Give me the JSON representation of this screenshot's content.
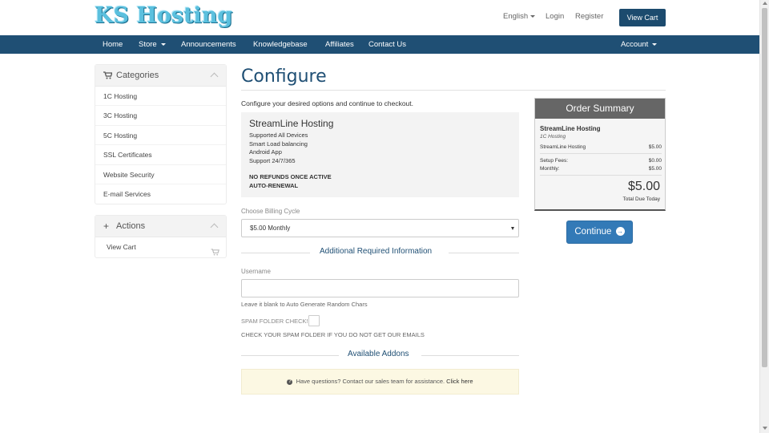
{
  "header": {
    "logo": "KS Hosting",
    "language": "English",
    "login": "Login",
    "register": "Register",
    "view_cart": "View Cart"
  },
  "nav": {
    "home": "Home",
    "store": "Store",
    "announcements": "Announcements",
    "knowledgebase": "Knowledgebase",
    "affiliates": "Affiliates",
    "contact": "Contact Us",
    "account": "Account"
  },
  "sidebar": {
    "categories_title": "Categories",
    "categories": [
      "1C Hosting",
      "3C Hosting",
      "5C Hosting",
      "SSL Certificates",
      "Website Security",
      "E-mail Services"
    ],
    "actions_title": "Actions",
    "actions": [
      "View Cart"
    ]
  },
  "main": {
    "title": "Configure",
    "intro": "Configure your desired options and continue to checkout.",
    "product": {
      "name": "StreamLine Hosting",
      "features": [
        "Supported All Devices",
        "Smart Load balancing",
        "Android App",
        "Support 24/7/365"
      ],
      "notes": [
        "NO REFUNDS ONCE ACTIVE",
        "AUTO-RENEWAL"
      ]
    },
    "billing_label": "Choose Billing Cycle",
    "billing_value": "$5.00 Monthly",
    "additional_info": "Additional Required Information",
    "username_label": "Username",
    "username_value": "",
    "username_help": "Leave it blank to Auto Generate Random Chars",
    "spam_label": "SPAM FOLDER CHECK!",
    "spam_help": "CHECK YOUR SPAM FOLDER IF YOU DO NOT GET OUR EMAILS",
    "addons_title": "Available Addons",
    "questions_text": "Have questions? Contact our sales team for assistance.",
    "questions_link": "Click here"
  },
  "summary": {
    "title": "Order Summary",
    "product": "StreamLine Hosting",
    "group": "1C Hosting",
    "line_label": "StreamLine Hosting",
    "line_value": "$5.00",
    "setup_label": "Setup Fees:",
    "setup_value": "$0.00",
    "monthly_label": "Monthly:",
    "monthly_value": "$5.00",
    "total": "$5.00",
    "total_label": "Total Due Today",
    "continue": "Continue"
  },
  "colors": {
    "navbar": "#1f4f74",
    "brand_button": "#1c4b6e",
    "continue_button": "#337ab7",
    "logo": "#5bc0de"
  }
}
